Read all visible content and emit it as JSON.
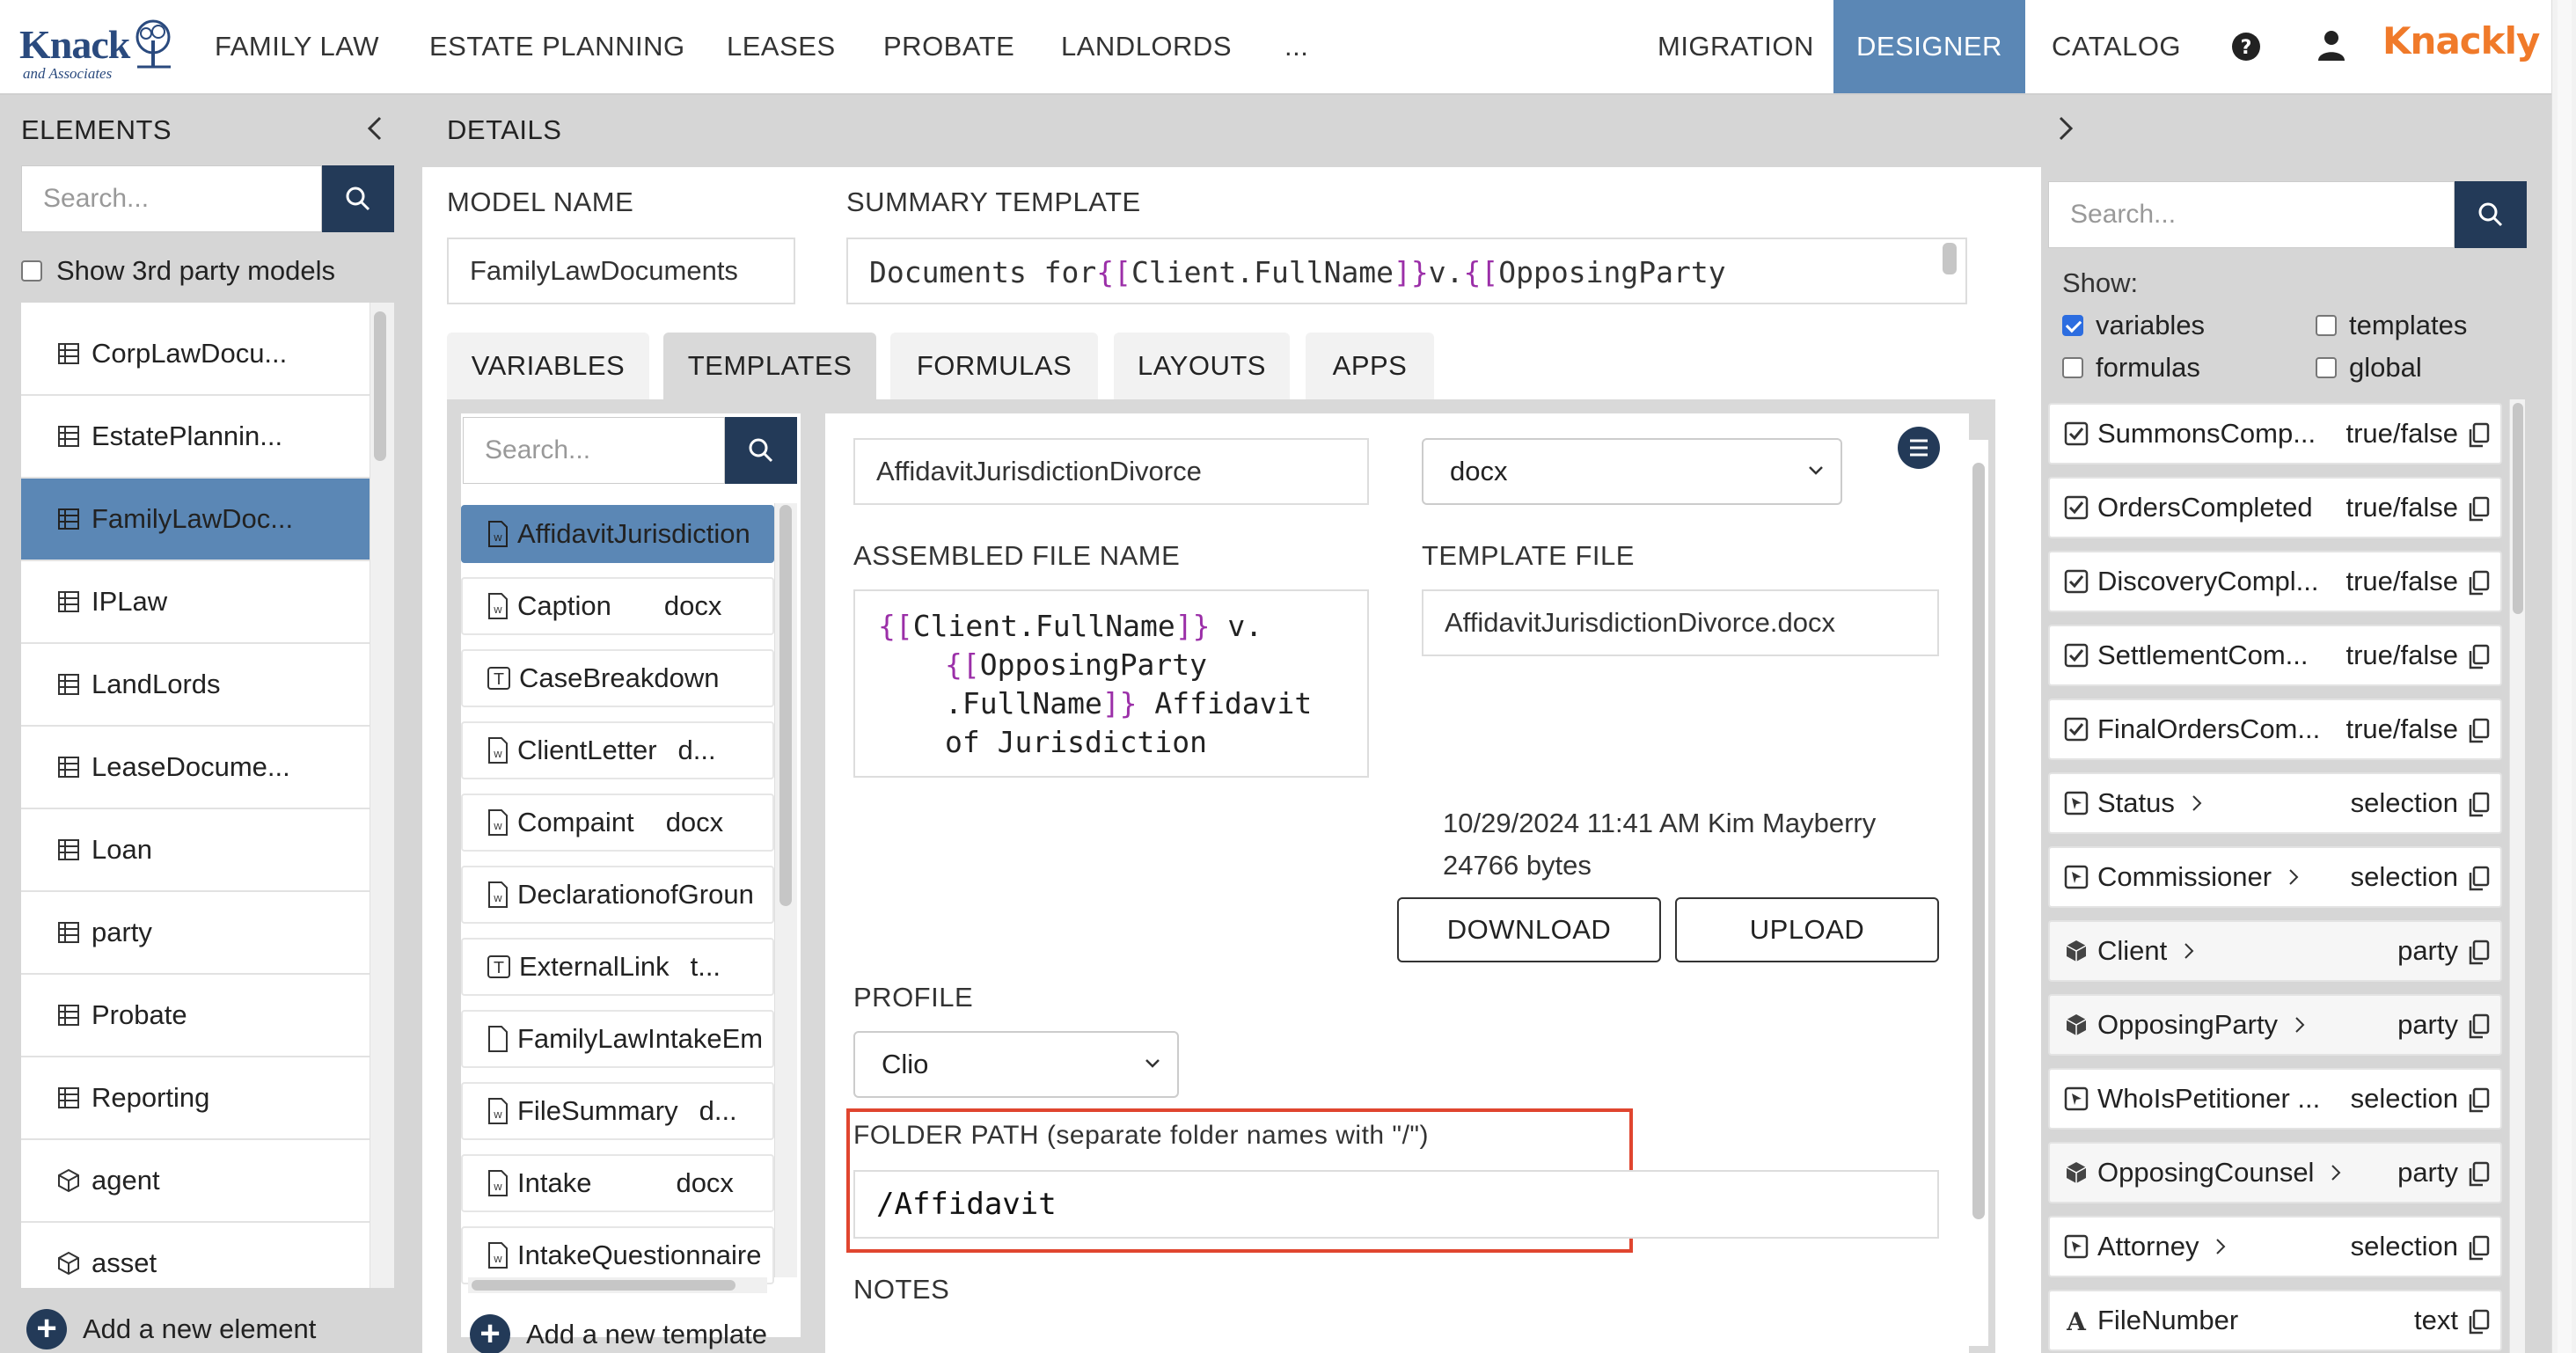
{
  "nav": {
    "logo_text": "Knack",
    "logo_sub": "and Associates",
    "left_items": [
      "FAMILY LAW",
      "ESTATE PLANNING",
      "LEASES",
      "PROBATE",
      "LANDLORDS",
      "..."
    ],
    "right_items": [
      "MIGRATION",
      "DESIGNER",
      "CATALOG"
    ],
    "brand": "Knackly",
    "accent": "#5b87b5",
    "brand_color": "#f07a2a"
  },
  "elements": {
    "title": "ELEMENTS",
    "search_placeholder": "Search...",
    "show_3rd_party_label": "Show 3rd party models",
    "items": [
      {
        "label": "CorpLawDocu...",
        "icon": "table-icon"
      },
      {
        "label": "EstatePlannin...",
        "icon": "table-icon"
      },
      {
        "label": "FamilyLawDoc...",
        "icon": "table-icon"
      },
      {
        "label": "IPLaw",
        "icon": "table-icon"
      },
      {
        "label": "LandLords",
        "icon": "table-icon"
      },
      {
        "label": "LeaseDocume...",
        "icon": "table-icon"
      },
      {
        "label": "Loan",
        "icon": "table-icon"
      },
      {
        "label": "party",
        "icon": "table-icon"
      },
      {
        "label": "Probate",
        "icon": "table-icon"
      },
      {
        "label": "Reporting",
        "icon": "table-icon"
      },
      {
        "label": "agent",
        "icon": "cube-icon"
      },
      {
        "label": "asset",
        "icon": "cube-icon"
      }
    ],
    "add_label": "Add a new element"
  },
  "details": {
    "title": "DETAILS",
    "model_name_label": "MODEL NAME",
    "model_name_value": "FamilyLawDocuments",
    "summary_label": "SUMMARY TEMPLATE",
    "summary_prefix": "Documents for ",
    "summary_var1": "Client.FullName",
    "summary_mid": " v. ",
    "summary_var2": "OpposingParty",
    "tabs": [
      "VARIABLES",
      "TEMPLATES",
      "FORMULAS",
      "LAYOUTS",
      "APPS"
    ]
  },
  "templates": {
    "search_placeholder": "Search...",
    "items": [
      {
        "name": "AffidavitJurisdiction",
        "type": "",
        "icon": "word-doc-icon"
      },
      {
        "name": "Caption",
        "type": "docx",
        "icon": "word-doc-icon"
      },
      {
        "name": "CaseBreakdown",
        "type": "",
        "icon": "text-template-icon"
      },
      {
        "name": "ClientLetter",
        "type": "d...",
        "icon": "word-doc-icon"
      },
      {
        "name": "Compaint",
        "type": "docx",
        "icon": "word-doc-icon"
      },
      {
        "name": "DeclarationofGroun",
        "type": "",
        "icon": "word-doc-icon"
      },
      {
        "name": "ExternalLink",
        "type": "t...",
        "icon": "text-template-icon"
      },
      {
        "name": "FamilyLawIntakeEm",
        "type": "",
        "icon": "blank-doc-icon"
      },
      {
        "name": "FileSummary",
        "type": "d...",
        "icon": "word-doc-icon"
      },
      {
        "name": "Intake",
        "type": "docx",
        "icon": "word-doc-icon"
      },
      {
        "name": "IntakeQuestionnaire",
        "type": "",
        "icon": "word-doc-icon"
      }
    ],
    "add_label": "Add a new template"
  },
  "template_detail": {
    "name_value": "AffidavitJurisdictionDivorce",
    "format_value": "docx",
    "assembled_label": "ASSEMBLED FILE NAME",
    "assembled_var1": "Client.FullName",
    "assembled_text1": " v.",
    "assembled_var2a": "OpposingParty",
    "assembled_var2b": ".FullName",
    "assembled_text2": " Affidavit",
    "assembled_text3": "of Jurisdiction",
    "template_file_label": "TEMPLATE FILE",
    "template_file_value": "AffidavitJurisdictionDivorce.docx",
    "modified_line": "10/29/2024 11:41 AM Kim Mayberry",
    "size_line": "24766 bytes",
    "download_label": "DOWNLOAD",
    "upload_label": "UPLOAD",
    "profile_label": "PROFILE",
    "profile_value": "Clio",
    "folder_label": "FOLDER PATH (separate folder names with \"/\")",
    "folder_value": "/Affidavit",
    "notes_label": "NOTES",
    "highlight_color": "#e0452f"
  },
  "vars_panel": {
    "search_placeholder": "Search...",
    "show_label": "Show:",
    "filters": [
      {
        "label": "variables",
        "checked": true
      },
      {
        "label": "templates",
        "checked": false
      },
      {
        "label": "formulas",
        "checked": false
      },
      {
        "label": "global",
        "checked": false
      }
    ],
    "items": [
      {
        "name": "SummonsComp...",
        "type": "true/false",
        "icon": "checkbox-icon"
      },
      {
        "name": "OrdersCompleted",
        "type": "true/false",
        "icon": "checkbox-icon"
      },
      {
        "name": "DiscoveryCompl...",
        "type": "true/false",
        "icon": "checkbox-icon"
      },
      {
        "name": "SettlementCom...",
        "type": "true/false",
        "icon": "checkbox-icon"
      },
      {
        "name": "FinalOrdersCom...",
        "type": "true/false",
        "icon": "checkbox-icon"
      },
      {
        "name": "Status",
        "type": "selection",
        "icon": "selection-icon"
      },
      {
        "name": "Commissioner",
        "type": "selection",
        "icon": "selection-icon"
      },
      {
        "name": "Client",
        "type": "party",
        "icon": "object-icon"
      },
      {
        "name": "OpposingParty",
        "type": "party",
        "icon": "object-icon"
      },
      {
        "name": "WhoIsPetitioner ...",
        "type": "selection",
        "icon": "selection-icon"
      },
      {
        "name": "OpposingCounsel",
        "type": "party",
        "icon": "object-icon"
      },
      {
        "name": "Attorney",
        "type": "selection",
        "icon": "selection-icon"
      },
      {
        "name": "FileNumber",
        "type": "text",
        "icon": "text-icon"
      }
    ]
  }
}
